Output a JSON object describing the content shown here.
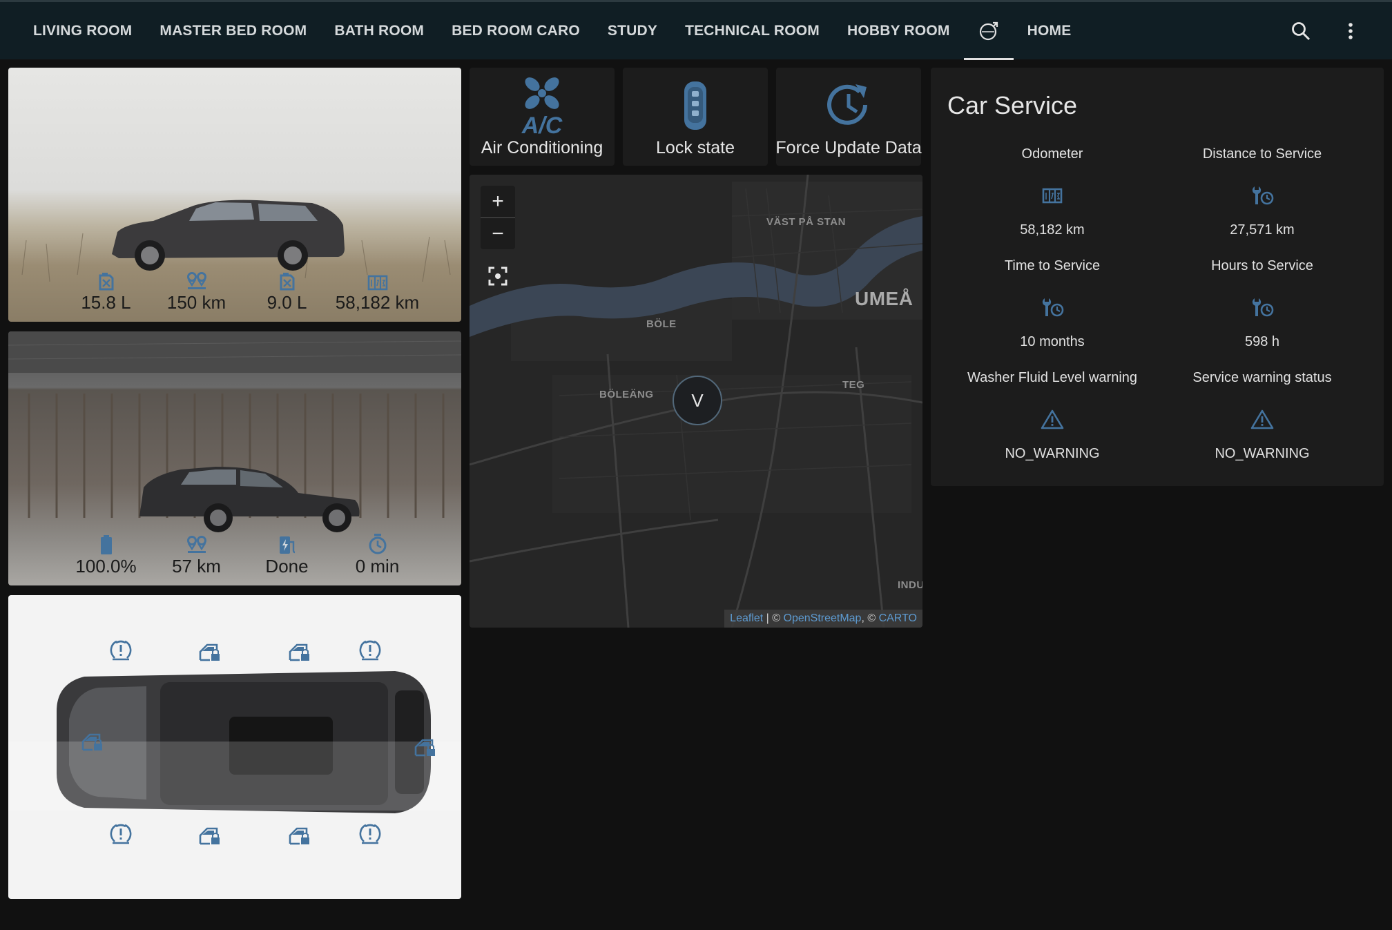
{
  "header": {
    "tabs": [
      {
        "label": "LIVING ROOM"
      },
      {
        "label": "MASTER BED ROOM"
      },
      {
        "label": "BATH ROOM"
      },
      {
        "label": "BED ROOM CARO"
      },
      {
        "label": "STUDY"
      },
      {
        "label": "TECHNICAL ROOM"
      },
      {
        "label": "HOBBY ROOM"
      },
      {
        "icon": "volvo-logo-icon",
        "active": true
      },
      {
        "label": "HOME"
      }
    ],
    "search_icon": "search-icon",
    "menu_icon": "dots-vertical-icon"
  },
  "car_card_1": {
    "stats": [
      {
        "icon": "fuel-can-icon",
        "value": "15.8 L"
      },
      {
        "icon": "map-marker-distance-icon",
        "value": "150 km"
      },
      {
        "icon": "fuel-can-icon",
        "value": "9.0 L"
      },
      {
        "icon": "counter-icon",
        "value": "58,182 km"
      }
    ]
  },
  "car_card_2": {
    "stats": [
      {
        "icon": "battery-icon",
        "value": "100.0%"
      },
      {
        "icon": "map-marker-distance-icon",
        "value": "57 km"
      },
      {
        "icon": "ev-station-icon",
        "value": "Done"
      },
      {
        "icon": "timer-icon",
        "value": "0 min"
      }
    ]
  },
  "buttons": {
    "air_conditioning": {
      "label": "Air Conditioning",
      "icon": "air-conditioner-icon"
    },
    "lock_state": {
      "label": "Lock state",
      "icon": "car-key-icon"
    },
    "force_update": {
      "label": "Force Update Data",
      "icon": "update-icon"
    }
  },
  "map": {
    "zoom_in": "+",
    "zoom_out": "−",
    "labels": {
      "vast_pa_stan": "VÄST PÅ STAN",
      "umea": "UMEÅ",
      "bole": "BÖLE",
      "boleang": "BÖLEÄNG",
      "teg": "TEG",
      "indu": "INDU"
    },
    "marker": "V",
    "attribution": {
      "leaflet": "Leaflet",
      "sep1": " | © ",
      "osm": "OpenStreetMap",
      "sep2": ", © ",
      "carto": "CARTO"
    }
  },
  "service": {
    "title": "Car Service",
    "items": [
      {
        "name": "Odometer",
        "icon": "counter-icon",
        "value": "58,182 km"
      },
      {
        "name": "Distance to Service",
        "icon": "wrench-clock-icon",
        "value": "27,571 km"
      },
      {
        "name": "Time to Service",
        "icon": "wrench-clock-icon",
        "value": "10 months"
      },
      {
        "name": "Hours to Service",
        "icon": "wrench-clock-icon",
        "value": "598 h"
      },
      {
        "name": "Washer Fluid Level warning",
        "icon": "alert-outline-icon",
        "value": "NO_WARNING"
      },
      {
        "name": "Service warning status",
        "icon": "alert-outline-icon",
        "value": "NO_WARNING"
      }
    ]
  },
  "colors": {
    "accent": "#44739e",
    "header_bg": "#101e24",
    "card_bg": "#1c1c1c",
    "page_bg": "#111111"
  }
}
